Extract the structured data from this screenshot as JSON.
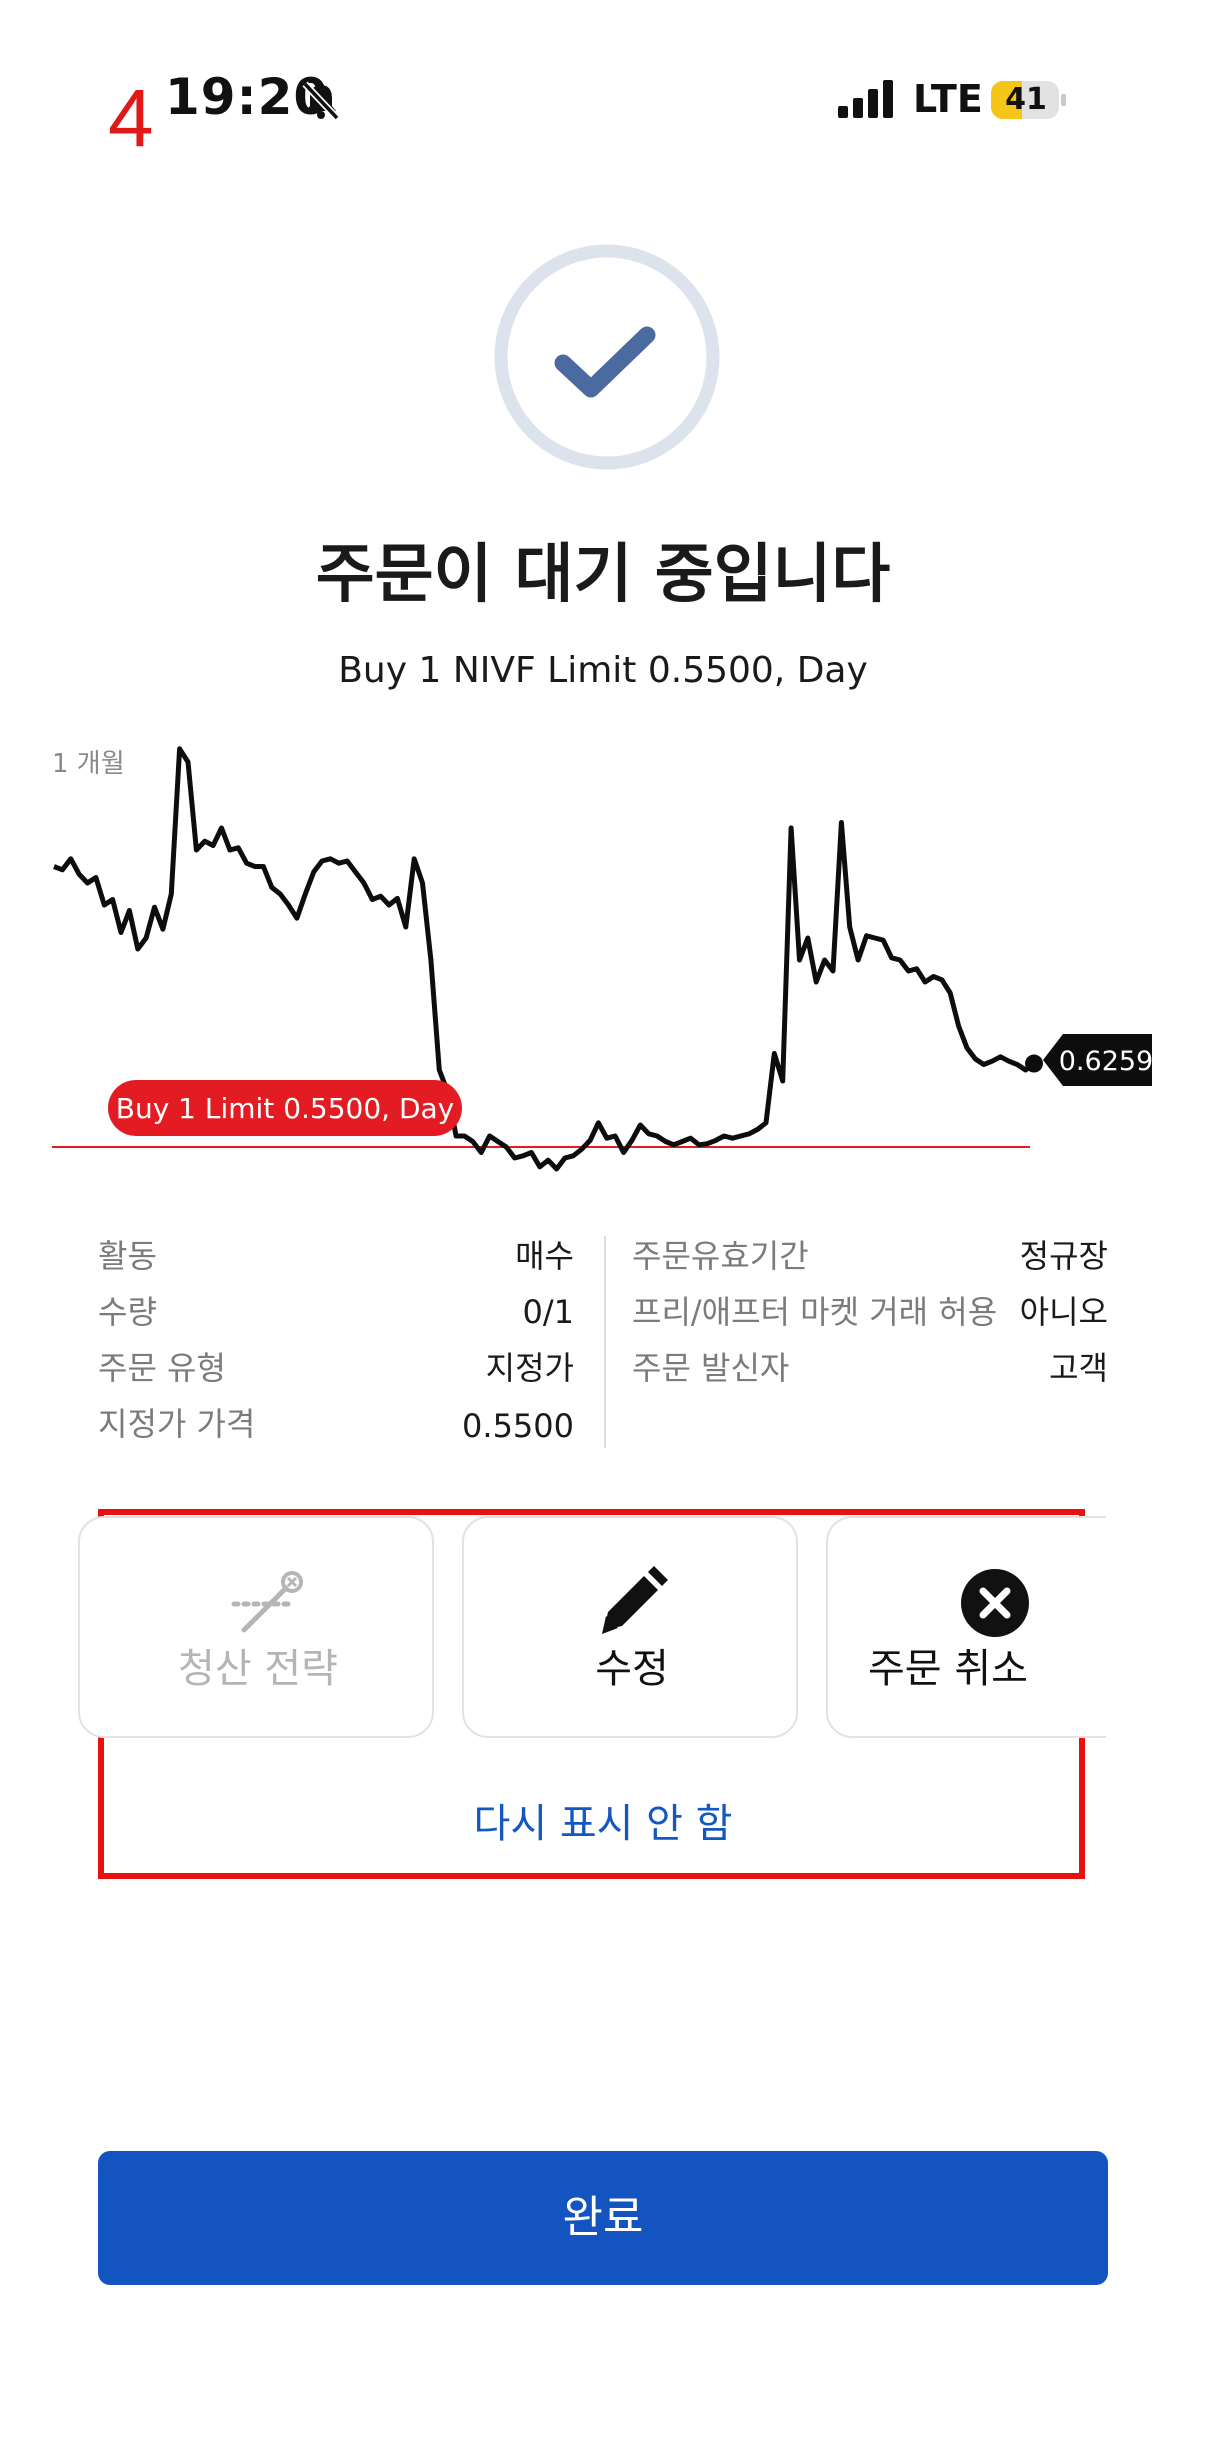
{
  "status_bar": {
    "step_marker": "4",
    "time": "19:20",
    "network": "LTE",
    "battery_level": "41",
    "battery_color": "#f5c518"
  },
  "header": {
    "title": "주문이 대기 중입니다",
    "summary": "Buy 1 NIVF Limit 0.5500, Day"
  },
  "chart": {
    "period_label": "1 개월",
    "current_price_label": "0.6259",
    "order_tag": "Buy 1 Limit 0.5500, Day"
  },
  "chart_data": {
    "type": "line",
    "title": "",
    "period": "1 개월",
    "current_price": 0.6259,
    "limit_line": 0.55,
    "limit_line_color": "#e31b23",
    "line_color": "#0d0d0d",
    "series": [
      {
        "values": [
          0.805,
          0.802,
          0.812,
          0.798,
          0.79,
          0.795,
          0.77,
          0.775,
          0.745,
          0.765,
          0.73,
          0.74,
          0.768,
          0.748,
          0.78,
          0.912,
          0.9,
          0.82,
          0.828,
          0.824,
          0.84,
          0.82,
          0.822,
          0.808,
          0.805,
          0.805,
          0.786,
          0.78,
          0.77,
          0.758,
          0.78,
          0.8,
          0.81,
          0.812,
          0.808,
          0.81,
          0.8,
          0.79,
          0.775,
          0.778,
          0.77,
          0.776,
          0.75,
          0.812,
          0.79,
          0.72,
          0.62,
          0.6,
          0.56,
          0.56,
          0.555,
          0.545,
          0.56,
          0.555,
          0.55,
          0.54,
          0.542,
          0.545,
          0.532,
          0.538,
          0.53,
          0.54,
          0.542,
          0.548,
          0.556,
          0.572,
          0.558,
          0.56,
          0.545,
          0.556,
          0.57,
          0.562,
          0.56,
          0.555,
          0.552,
          0.555,
          0.558,
          0.552,
          0.553,
          0.556,
          0.56,
          0.558,
          0.56,
          0.562,
          0.566,
          0.572,
          0.635,
          0.61,
          0.84,
          0.72,
          0.74,
          0.7,
          0.72,
          0.71,
          0.845,
          0.75,
          0.72,
          0.742,
          0.74,
          0.738,
          0.722,
          0.72,
          0.71,
          0.712,
          0.7,
          0.705,
          0.702,
          0.69,
          0.66,
          0.64,
          0.63,
          0.625,
          0.628,
          0.632,
          0.628,
          0.625,
          0.62,
          0.6259
        ]
      }
    ],
    "xlabel": "",
    "ylabel": "",
    "ylim": [
      0.52,
      0.92
    ],
    "grid": false
  },
  "details": {
    "left": [
      {
        "label": "활동",
        "value": "매수"
      },
      {
        "label": "수량",
        "value": "0/1"
      },
      {
        "label": "주문 유형",
        "value": "지정가"
      },
      {
        "label": "지정가 가격",
        "value": "0.5500"
      }
    ],
    "right": [
      {
        "label": "주문유효기간",
        "value": "정규장"
      },
      {
        "label": "프리/애프터 마켓 거래 허용",
        "value": "아니오"
      },
      {
        "label": "주문 발신자",
        "value": "고객"
      }
    ]
  },
  "actions": {
    "exit_strategy": {
      "label": "청산 전략",
      "icon": "exit-strategy-icon",
      "enabled": false
    },
    "modify": {
      "label": "수정",
      "icon": "pencil-icon",
      "enabled": true
    },
    "cancel": {
      "label": "주문 취소",
      "icon": "close-circle-icon",
      "enabled": true
    },
    "dismiss_link": "다시 표시 안 함"
  },
  "footer": {
    "done_label": "완료",
    "done_color": "#1454c0"
  },
  "colors": {
    "accent_blue": "#1557c0",
    "check_icon": "#4a6aa0",
    "check_ring": "#dde3ec",
    "annotation_red": "#ea1010"
  }
}
